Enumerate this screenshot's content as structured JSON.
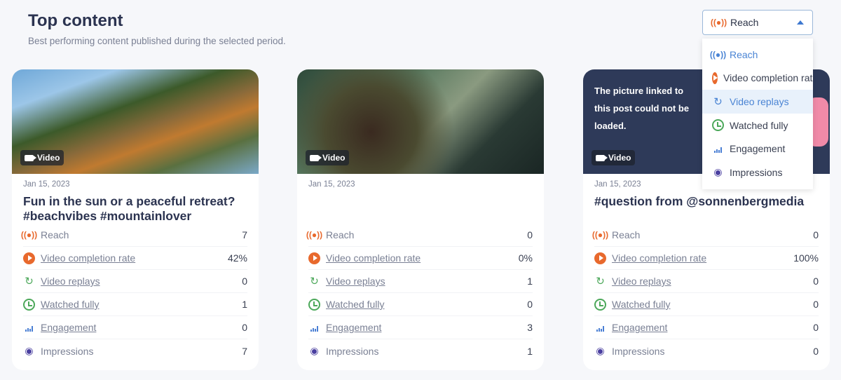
{
  "header": {
    "title": "Top content",
    "subtitle": "Best performing content published during the selected period."
  },
  "metric_select": {
    "selected": "Reach",
    "options": [
      {
        "label": "Reach",
        "icon": "reach-icon"
      },
      {
        "label": "Video completion rate",
        "icon": "play-icon"
      },
      {
        "label": "Video replays",
        "icon": "replay-icon"
      },
      {
        "label": "Watched fully",
        "icon": "clock-icon"
      },
      {
        "label": "Engagement",
        "icon": "bar-chart-icon"
      },
      {
        "label": "Impressions",
        "icon": "eye-icon"
      }
    ],
    "highlighted": "Video replays"
  },
  "metric_labels": [
    "Reach",
    "Video completion rate",
    "Video replays",
    "Watched fully",
    "Engagement",
    "Impressions"
  ],
  "cards": [
    {
      "badge": "Video",
      "date": "Jan 15, 2023",
      "title": "Fun in the sun or a peaceful retreat? #beachvibes #mountainlover",
      "values": [
        "7",
        "42%",
        "0",
        "1",
        "0",
        "7"
      ]
    },
    {
      "badge": "Video",
      "date": "Jan 15, 2023",
      "title": "",
      "values": [
        "0",
        "0%",
        "1",
        "0",
        "3",
        "1"
      ]
    },
    {
      "badge": "Video",
      "date": "Jan 15, 2023",
      "title": "#question from @sonnenbergmedia",
      "image_error": "The picture linked to this post could not be loaded.",
      "values": [
        "0",
        "100%",
        "0",
        "0",
        "0",
        "0"
      ]
    }
  ],
  "colors": {
    "accent": "#4a84d4",
    "orange": "#e8692d",
    "green": "#4ca85a",
    "purple": "#4a3fa0"
  }
}
